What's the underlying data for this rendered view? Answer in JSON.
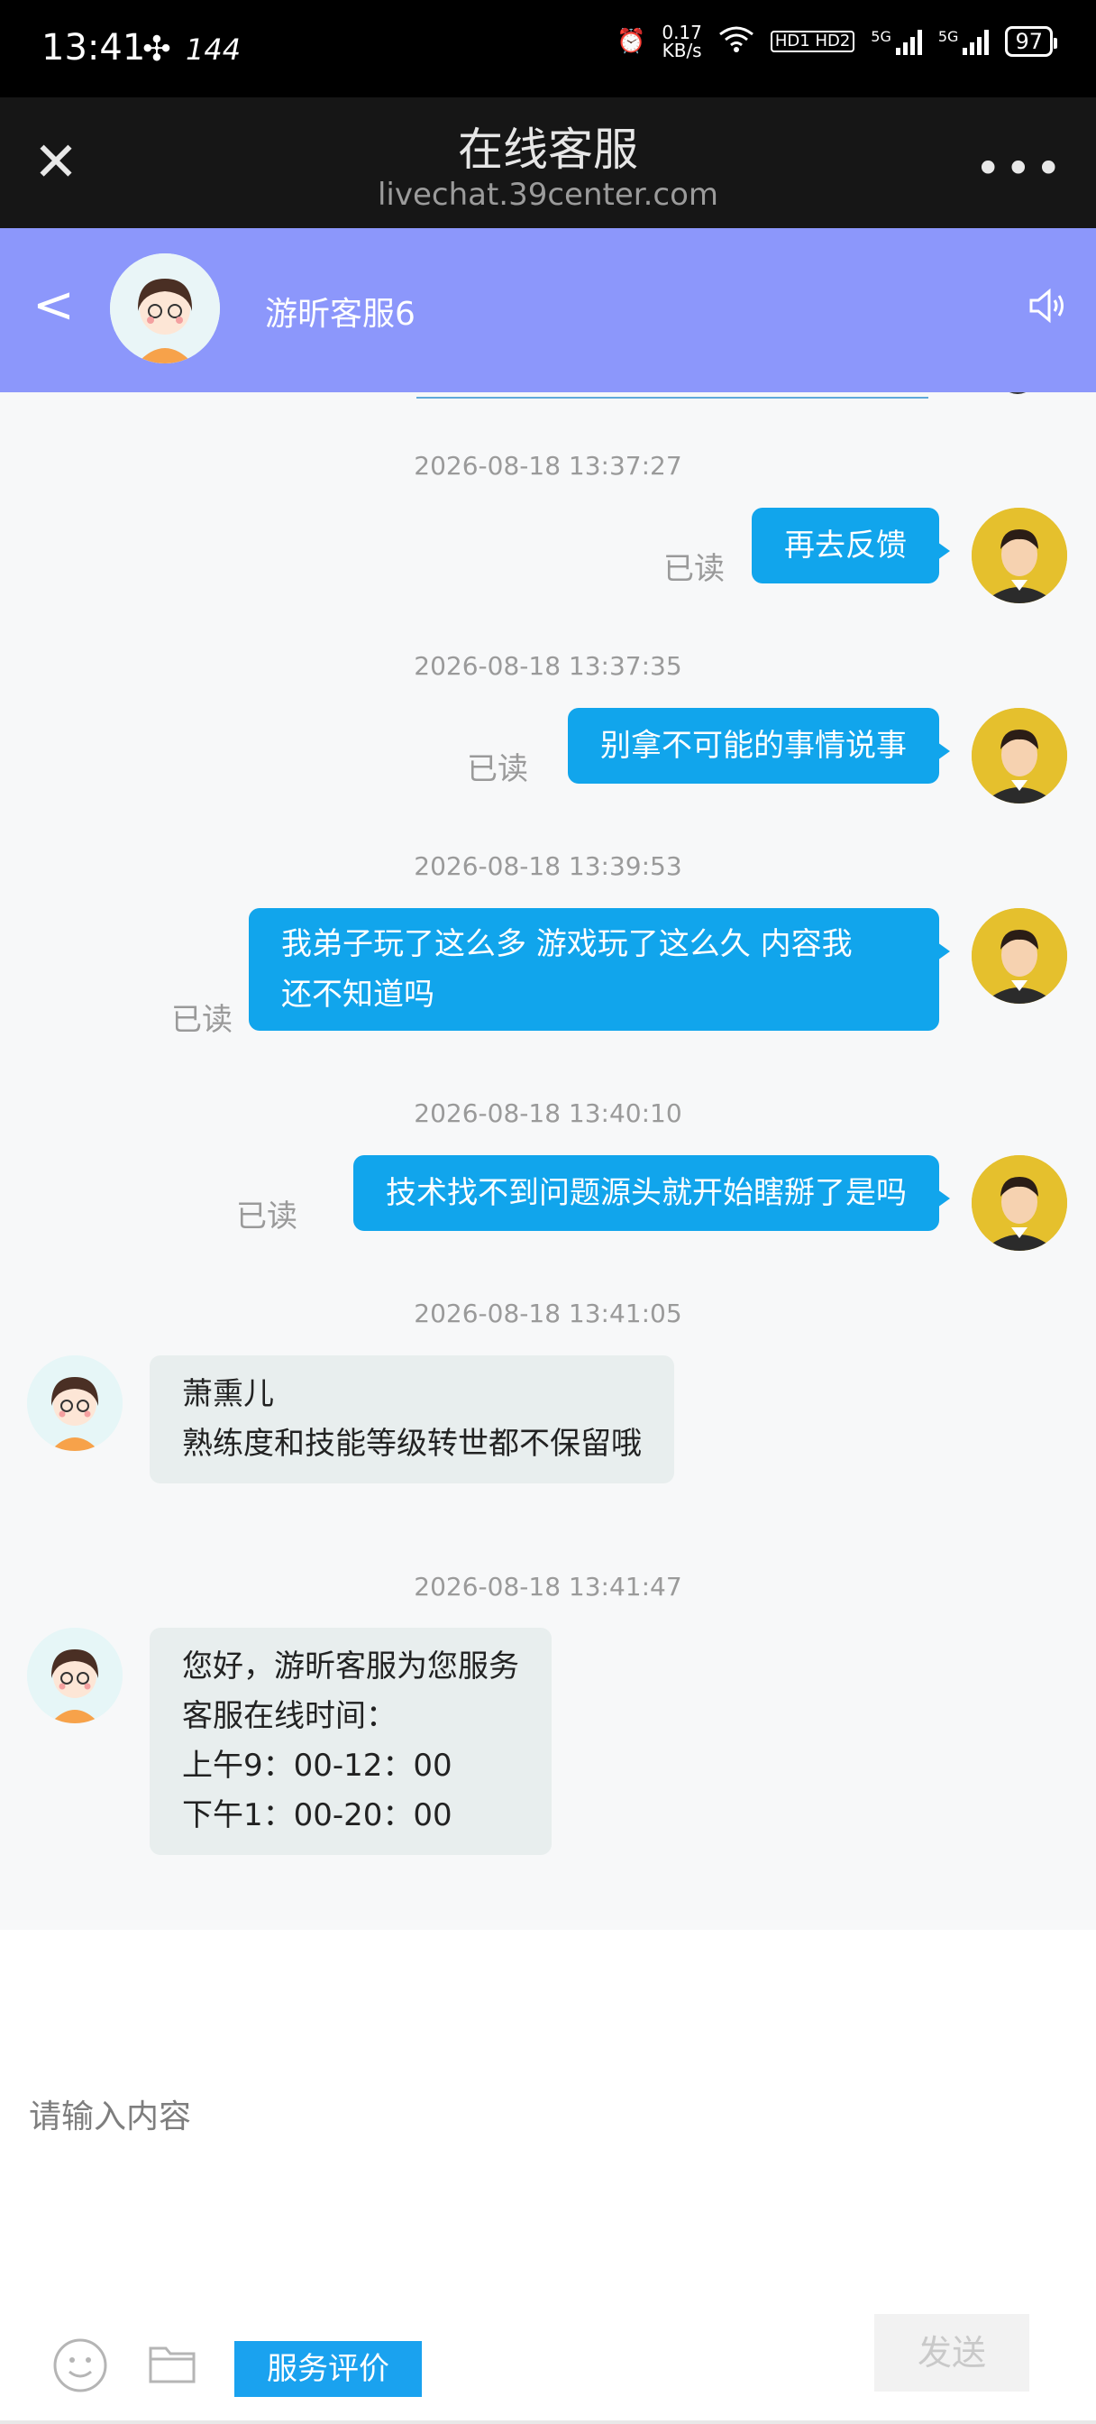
{
  "status_bar": {
    "time": "13:41",
    "refresh_rate": "144",
    "net_speed_value": "0.17",
    "net_speed_unit": "KB/s",
    "hd_tag": "HD1 HD2",
    "sim1": "5G",
    "sim2": "5G",
    "battery": "97"
  },
  "browser": {
    "title": "在线客服",
    "url": "livechat.39center.com",
    "close_icon": "close-icon",
    "more_icon": "more-icon"
  },
  "chat_header": {
    "agent_name": "游昕客服6",
    "back_icon": "back-icon",
    "sound_icon": "speaker-icon"
  },
  "colors": {
    "header_bg": "#8c97fb",
    "bubble_out": "#11a5ec",
    "bubble_in": "#e8eeee",
    "rate_button": "#1aa2ef"
  },
  "messages": [
    {
      "timestamp": "2026-08-18 13:37:27",
      "direction": "out",
      "read": "已读",
      "lines": [
        "再去反馈"
      ]
    },
    {
      "timestamp": "2026-08-18 13:37:35",
      "direction": "out",
      "read": "已读",
      "lines": [
        "别拿不可能的事情说事"
      ]
    },
    {
      "timestamp": "2026-08-18 13:39:53",
      "direction": "out",
      "read": "已读",
      "lines": [
        "我弟子玩了这么多 游戏玩了这么久 内容我",
        "还不知道吗"
      ]
    },
    {
      "timestamp": "2026-08-18 13:40:10",
      "direction": "out",
      "read": "已读",
      "lines": [
        "技术找不到问题源头就开始瞎掰了是吗"
      ]
    },
    {
      "timestamp": "2026-08-18 13:41:05",
      "direction": "in",
      "lines": [
        "萧熏儿",
        "熟练度和技能等级转世都不保留哦"
      ]
    },
    {
      "timestamp": "2026-08-18 13:41:47",
      "direction": "in",
      "lines": [
        "您好，游昕客服为您服务",
        "客服在线时间：",
        "上午9：00-12：00",
        "下午1：00-20：00"
      ]
    }
  ],
  "input": {
    "placeholder": "请输入内容",
    "rate_label": "服务评价",
    "send_label": "发送",
    "emoji_icon": "smile-icon",
    "file_icon": "folder-icon"
  }
}
